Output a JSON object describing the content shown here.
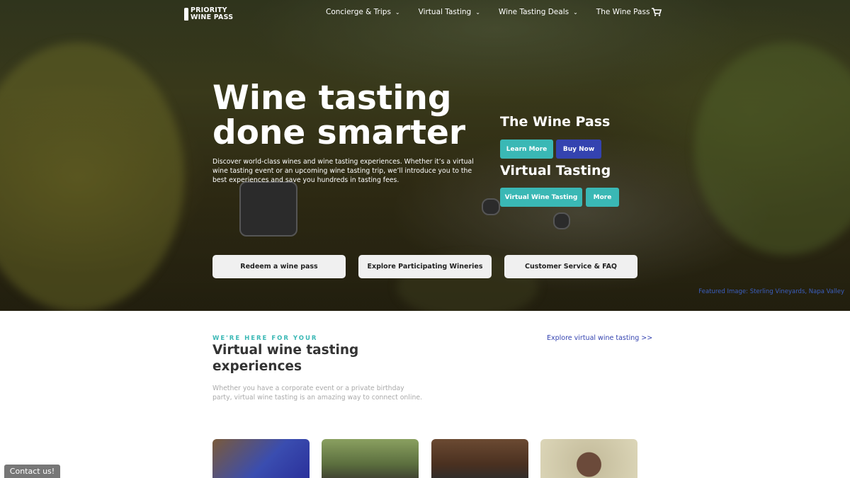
{
  "nav": {
    "logo_line1": "PRIORITY",
    "logo_line2": "WINE PASS",
    "items": [
      {
        "label": "Concierge & Trips"
      },
      {
        "label": "Virtual Tasting"
      },
      {
        "label": "Wine Tasting Deals"
      },
      {
        "label": "The Wine Pass"
      }
    ],
    "cart_icon": "cart-icon"
  },
  "hero": {
    "title": "Wine tasting done smarter",
    "description": "Discover world-class wines and wine tasting experiences. Whether it’s a virtual wine tasting event or an upcoming wine tasting trip, we’ll introduce you to the best experiences and save you hundreds in tasting fees.",
    "wine_pass_heading": "The Wine Pass",
    "learn_more": "Learn More",
    "buy_now": "Buy Now",
    "virtual_heading": "Virtual Tasting",
    "virtual_wine_tasting": "Virtual Wine Tasting",
    "more": "More",
    "redeem": "Redeem a wine pass",
    "explore_wineries": "Explore Participating Wineries",
    "customer_service": "Customer Service & FAQ",
    "featured_caption": "Featured Image: Sterling Vineyards, Napa Valley"
  },
  "section": {
    "eyebrow": "WE'RE HERE FOR YOUR",
    "title": "Virtual wine tasting experiences",
    "description": "Whether you have a corporate event or a private birthday party, virtual wine tasting is an amazing way to connect online.",
    "explore_link": "Explore virtual wine tasting >>"
  },
  "contact": "Contact us!",
  "colors": {
    "teal": "#3ab8b5",
    "blue": "#3443b0",
    "caption_blue": "#3b5fc0"
  }
}
